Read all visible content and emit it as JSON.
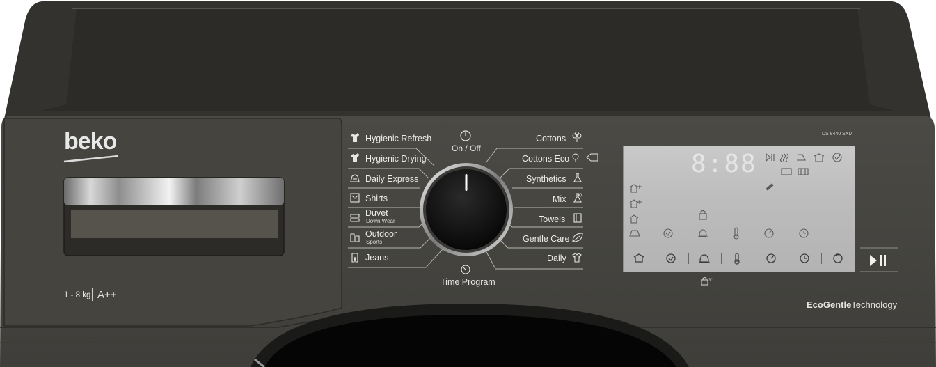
{
  "brand": {
    "logo_text": "beko"
  },
  "capacity": {
    "load": "1 - 8 kg",
    "energy_class": "A++"
  },
  "model": "DS 8440 SXM",
  "technology": {
    "eco_gentle": "EcoGentle",
    "technology_word": "Technology"
  },
  "dial": {
    "on_off_label": "On / Off",
    "time_program_label": "Time Program"
  },
  "programs_left": [
    {
      "label": "Hygienic Refresh",
      "icon": "hygiene-shirt-icon"
    },
    {
      "label": "Hygienic Drying",
      "icon": "hygiene-shirt-icon"
    },
    {
      "label": "Daily Express",
      "icon": "express-icon"
    },
    {
      "label": "Shirts",
      "icon": "shirt-icon"
    },
    {
      "label": "Duvet",
      "sub": "Down Wear",
      "icon": "duvet-icon"
    },
    {
      "label": "Outdoor",
      "sub": "Sports",
      "icon": "outdoor-icon"
    },
    {
      "label": "Jeans",
      "icon": "jeans-icon"
    }
  ],
  "programs_right": [
    {
      "label": "Cottons",
      "icon": "cotton-flower-icon"
    },
    {
      "label": "Cottons Eco",
      "icon": "cotton-eco-icon"
    },
    {
      "label": "Synthetics",
      "icon": "synthetics-flask-icon"
    },
    {
      "label": "Mix",
      "icon": "mix-icon"
    },
    {
      "label": "Towels",
      "icon": "towel-icon"
    },
    {
      "label": "Gentle Care",
      "icon": "leaf-icon"
    },
    {
      "label": "Daily",
      "icon": "daily-shirt-icon"
    }
  ],
  "display": {
    "digits": "8:88",
    "top_icons": [
      "play-pause-icon",
      "steam-icon",
      "iron-icon",
      "hanger-icon",
      "check-icon"
    ],
    "side_icons": [
      "dry-plus-icon",
      "dry-icon",
      "dry-level-icon",
      "iron-dry-icon"
    ],
    "mid_icons": [
      "delay-icon",
      "lock-icon",
      "bell-icon",
      "temperature-icon",
      "timer-icon",
      "clock-icon"
    ],
    "buttons": [
      "dry-level-button",
      "delay-button",
      "alarm-button",
      "temperature-button",
      "time-button",
      "end-time-button",
      "sync-button"
    ]
  },
  "start_pause_icon": "play-pause-icon",
  "child_lock_label": "3\""
}
